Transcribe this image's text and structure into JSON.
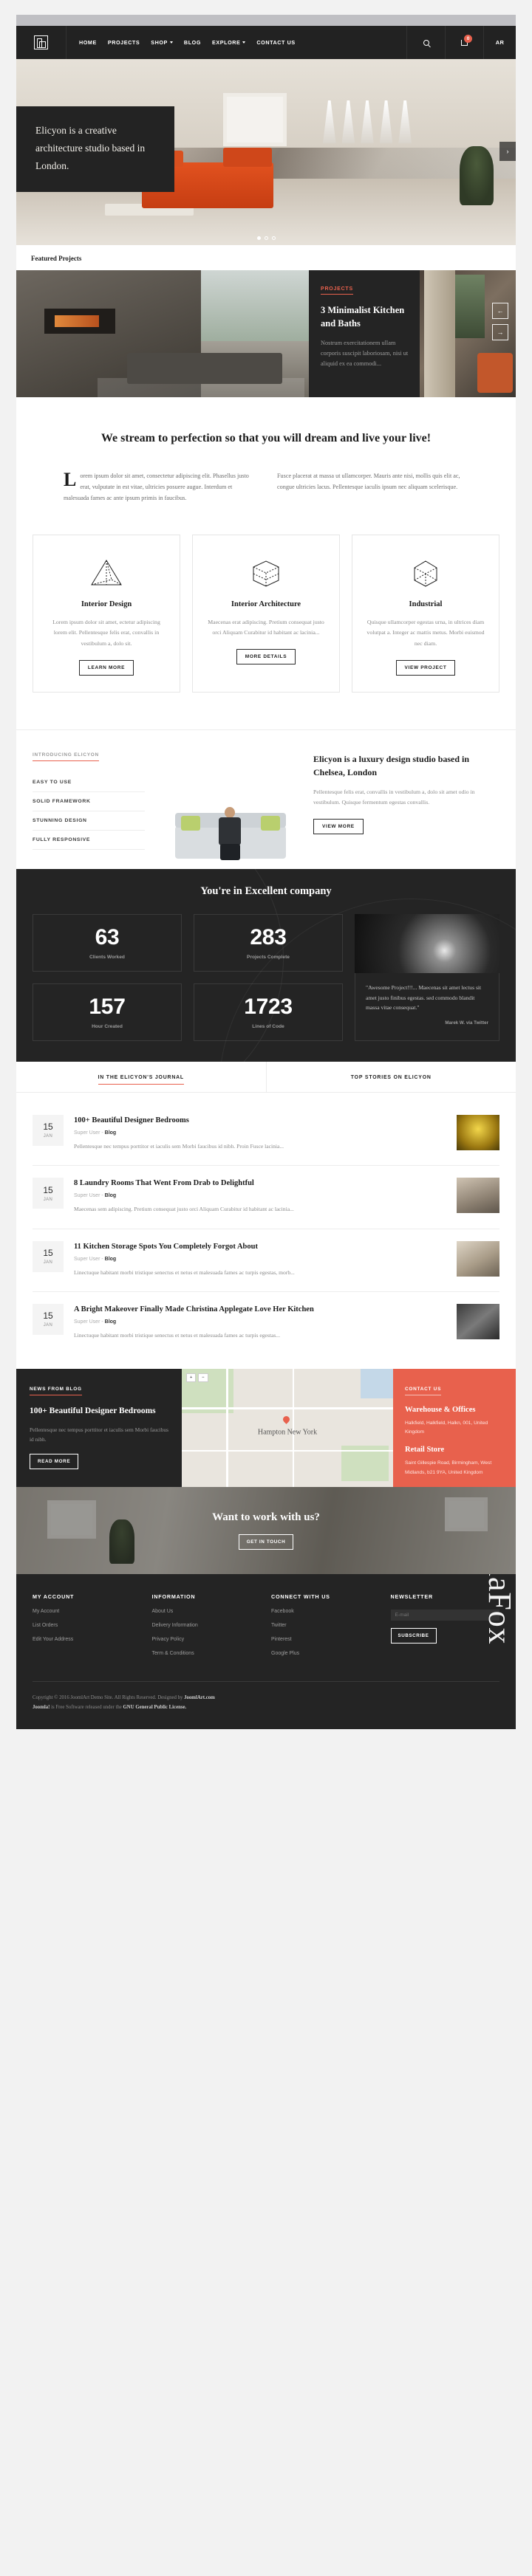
{
  "nav": {
    "logo_alt": "elicyon-logo",
    "items": [
      {
        "label": "HOME",
        "caret": false
      },
      {
        "label": "PROJECTS",
        "caret": false
      },
      {
        "label": "SHOP",
        "caret": true
      },
      {
        "label": "BLOG",
        "caret": false
      },
      {
        "label": "EXPLORE",
        "caret": true
      },
      {
        "label": "CONTACT US",
        "caret": false
      }
    ],
    "cart_count": "0",
    "language": "AR"
  },
  "hero": {
    "caption": "Elicyon is a creative architecture studio based in London.",
    "next_arrow": "›"
  },
  "featured": {
    "heading": "Featured Projects",
    "category": "PROJECTS",
    "title": "3 Minimalist Kitchen and Baths",
    "description": "Nostrum exercitationem ullam corporis suscipit laboriosam, nisi ut aliquid ex ea commodi...",
    "prev": "←",
    "next": "→"
  },
  "intro": {
    "heading": "We stream to perfection so that you will dream and live your live!",
    "dropcap": "L",
    "col1": "orem ipsum dolor sit amet, consectetur adipiscing elit. Phasellus justo erat, vulputate in est vitae, ultricies posuere augue. Interdum et malesuada fames ac ante ipsum primis in faucibus.",
    "col2": "Fusce placerat at massa ut ullamcorper. Mauris ante nisi, mollis quis elit ac, congue ultricies lacus. Pellentesque iaculis ipsum nec aliquam scelerisque."
  },
  "services": [
    {
      "icon": "pyramid-icon",
      "title": "Interior Design",
      "text": "Lorem ipsum dolor sit amet, ectetur adipiscing lorem elit. Pellentesque felis erat, convallis in vestibulum a, dolo sit.",
      "button": "LEARN MORE"
    },
    {
      "icon": "cube-icon",
      "title": "Interior Architecture",
      "text": "Maecenas erat adipiscing. Pretium consequat justo orci Aliquam Curabitur id habitant ac lacinia...",
      "button": "MORE DETAILS"
    },
    {
      "icon": "polygon-icon",
      "title": "Industrial",
      "text": "Quisque ullamcorper egestas urna, in ultrices diam volutpat a. Integer ac mattis metus. Morbi euismod nec diam.",
      "button": "VIEW PROJECT"
    }
  ],
  "about": {
    "tag": "INTRODUCING ELICYON",
    "features": [
      "EASY TO USE",
      "SOLID FRAMEWORK",
      "STUNNING DESIGN",
      "FULLY RESPONSIVE"
    ],
    "title": "Elicyon is a luxury design studio based in Chelsea, London",
    "text": "Pellentesque felis erat, convallis in vestibulum a, dolo sit amet odio in vestibulum. Quisque fermentum egestas convallis.",
    "button": "VIEW MORE"
  },
  "stats": {
    "heading": "You're in Excellent company",
    "items": [
      {
        "value": "63",
        "label": "Clients Worked"
      },
      {
        "value": "283",
        "label": "Projects Complete"
      },
      {
        "value": "157",
        "label": "Hour Created"
      },
      {
        "value": "1723",
        "label": "Lines of Code"
      }
    ],
    "quote": "\"Awesome Project!!!... Maecenas sit amet lectus sit amet justo finibus egestas. sed commodo blandit massa vitae consequat.\"",
    "quote_author": "Marek W. via Twitter"
  },
  "blog": {
    "tabs": [
      {
        "label": "IN THE ELICYON'S JOURNAL",
        "active": true
      },
      {
        "label": "TOP STORIES ON ELICYON",
        "active": false
      }
    ],
    "posts": [
      {
        "day": "15",
        "month": "JAN",
        "title": "100+ Beautiful Designer Bedrooms",
        "author": "Super User",
        "category": "Blog",
        "excerpt": "Pellentesque nec tempus porttitor et iaculis sem Morbi faucibus id nibh. Proin Fusce lacinia...",
        "thumb": "t1"
      },
      {
        "day": "15",
        "month": "JAN",
        "title": "8 Laundry Rooms That Went From Drab to Delightful",
        "author": "Super User",
        "category": "Blog",
        "excerpt": "Maecenas sem adipiscing. Pretium consequat justo orci Aliquam Curabitur id habitant ac lacinia...",
        "thumb": "t2"
      },
      {
        "day": "15",
        "month": "JAN",
        "title": "11 Kitchen Storage Spots You Completely Forgot About",
        "author": "Super User",
        "category": "Blog",
        "excerpt": "Linectuque habitant morbi tristique senectus et netus et malesuada fames ac turpis egestas, morb...",
        "thumb": "t3"
      },
      {
        "day": "15",
        "month": "JAN",
        "title": "A Bright Makeover Finally Made Christina Applegate Love Her Kitchen",
        "author": "Super User",
        "category": "Blog",
        "excerpt": "Linectuque habitant morbi tristique senectus et netus et malesuada fames ac turpis egestas...",
        "thumb": "t4"
      }
    ]
  },
  "news": {
    "cat": "NEWS FROM BLOG",
    "title": "100+ Beautiful Designer Bedrooms",
    "text": "Pellentesque nec tempus porttitor et iaculis sem Morbi faucibus id nibh.",
    "button": "READ MORE"
  },
  "map": {
    "label": "Hampton New York",
    "zoom_in": "+",
    "zoom_out": "−",
    "pin": "map-pin"
  },
  "contact": {
    "cat": "CONTACT US",
    "office_title": "Warehouse & Offices",
    "office_addr": "Halkfield, Halkfield, Halkn, 001, United Kingdom",
    "store_title": "Retail Store",
    "store_addr": "Saint Gillespie Road, Birmingham, West Midlands, b21 9YA, United Kingdom"
  },
  "cta": {
    "heading": "Want to work with us?",
    "button": "GET IN TOUCH"
  },
  "footer": {
    "columns": [
      {
        "title": "MY ACCOUNT",
        "links": [
          "My Account",
          "List Orders",
          "Edit Your Address"
        ]
      },
      {
        "title": "INFORMATION",
        "links": [
          "About Us",
          "Delivery Information",
          "Privacy Policy",
          "Term & Conditions"
        ]
      },
      {
        "title": "CONNECT WITH US",
        "links": [
          "Facebook",
          "Twitter",
          "Pinterest",
          "Google Plus"
        ]
      }
    ],
    "newsletter_title": "NEWSLETTER",
    "newsletter_placeholder": "E-mail",
    "subscribe": "SUBSCRIBE",
    "copyright_prefix": "Copyright © 2016 JoomlArt Demo Site. All Rights Reserved. Designed by ",
    "copyright_link": "JoomlArt.com",
    "license_a": "Joomla!",
    "license_b": " is Free Software released under the ",
    "license_link": "GNU General Public License.",
    "watermark": "JoomlaFox"
  },
  "colors": {
    "accent": "#e8614d",
    "dark": "#242424",
    "page_bg": "#f2f2f2"
  }
}
